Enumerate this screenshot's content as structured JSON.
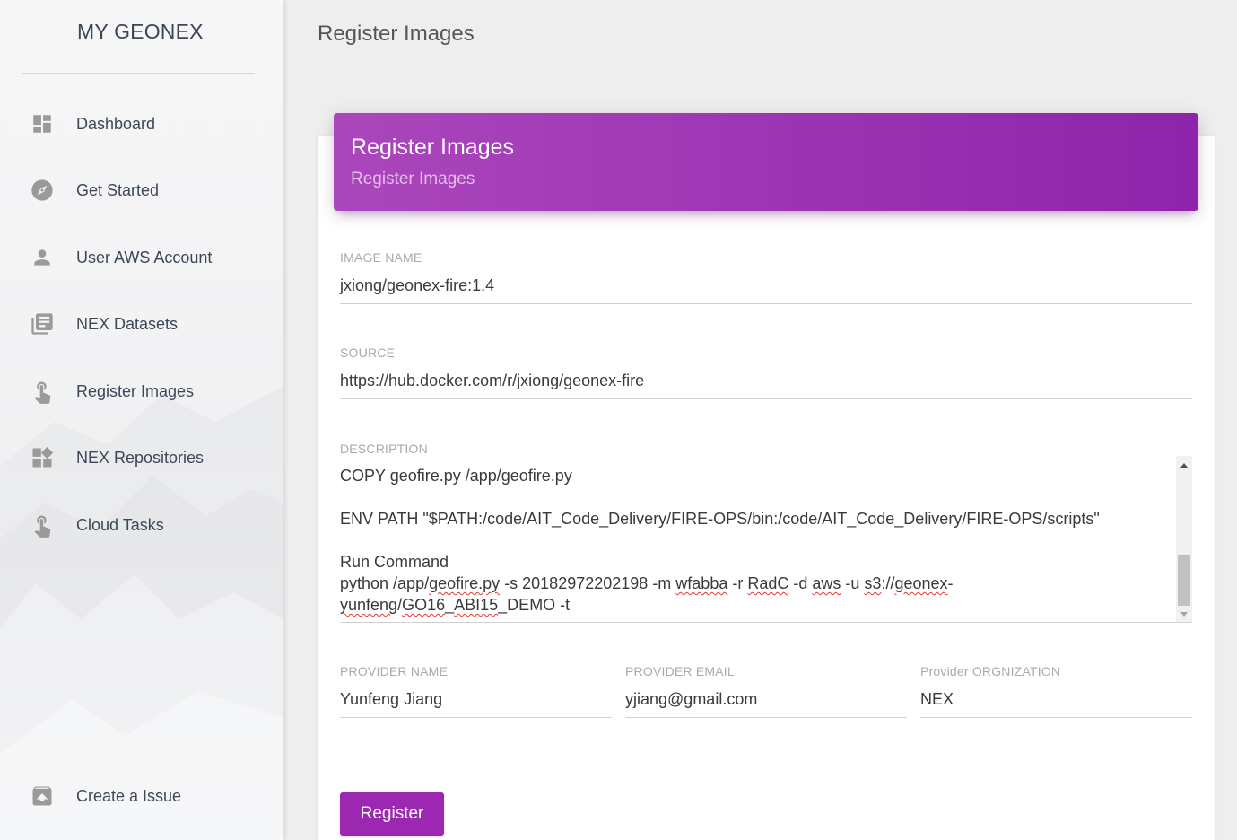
{
  "brand": "MY GEONEX",
  "nav": [
    {
      "label": "Dashboard",
      "icon": "dashboard-icon"
    },
    {
      "label": "Get Started",
      "icon": "compass-icon"
    },
    {
      "label": "User AWS Account",
      "icon": "person-icon"
    },
    {
      "label": "NEX Datasets",
      "icon": "library-books-icon"
    },
    {
      "label": "Register Images",
      "icon": "touch-app-icon"
    },
    {
      "label": "NEX Repositories",
      "icon": "widgets-icon"
    },
    {
      "label": "Cloud Tasks",
      "icon": "touch-app-icon"
    }
  ],
  "footer_nav": {
    "label": "Create a Issue",
    "icon": "unarchive-icon"
  },
  "page_title": "Register Images",
  "card": {
    "title": "Register Images",
    "subtitle": "Register Images"
  },
  "form": {
    "image_name": {
      "label": "IMAGE NAME",
      "value": "jxiong/geonex-fire:1.4"
    },
    "source": {
      "label": "SOURCE",
      "value": "https://hub.docker.com/r/jxiong/geonex-fire"
    },
    "description": {
      "label": "DESCRIPTION",
      "line1": "COPY geofire.py /app/geofire.py",
      "line2": "ENV PATH \"$PATH:/code/AIT_Code_Delivery/FIRE-OPS/bin:/code/AIT_Code_Delivery/FIRE-OPS/scripts\"",
      "line3": "Run Command",
      "line4": {
        "a": "python /app/",
        "b": "geofire.py",
        "c": " -s 20182972202198 -m ",
        "d": "wfabba",
        "e": " -r ",
        "f": "RadC",
        "g": " -d ",
        "h": "aws",
        "i": " -u ",
        "j": "s3",
        "k": "://",
        "l": "geonex",
        "m": "-"
      },
      "line5": {
        "a": "yunfeng",
        "b": "/",
        "c": "GO16",
        "d": "_",
        "e": "ABI15",
        "f": "_DEMO -t"
      }
    },
    "provider_name": {
      "label": "PROVIDER NAME",
      "value": "Yunfeng Jiang"
    },
    "provider_email": {
      "label": "PROVIDER EMAIL",
      "value": "yjiang@gmail.com"
    },
    "provider_org": {
      "label": "Provider ORGNIZATION",
      "value": "NEX"
    },
    "submit_label": "Register"
  },
  "colors": {
    "accent": "#9c27b0",
    "header_start": "#ab47bc",
    "header_end": "#8e24aa"
  }
}
